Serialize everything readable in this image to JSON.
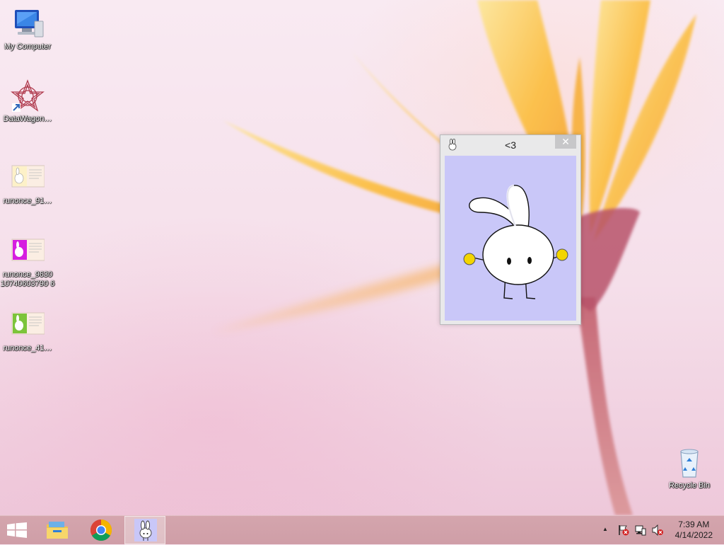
{
  "desktop": {
    "icons": [
      {
        "label": "My Computer",
        "icon": "computer-icon"
      },
      {
        "label": "DataWagon…",
        "icon": "datawagon-icon"
      },
      {
        "label": "runonce_91…",
        "icon": "image-file-icon"
      },
      {
        "label": "runonce_9630 10740603790 6",
        "icon": "image-file-icon"
      },
      {
        "label": "runonce_41…",
        "icon": "image-file-icon"
      },
      {
        "label": "Recycle Bin",
        "icon": "recycle-bin-icon"
      }
    ]
  },
  "window": {
    "title": "<3",
    "close_label": "✕",
    "icon": "bunny-icon",
    "colors": {
      "content_bg": "#c9c7f8",
      "hand": "#f3d500"
    }
  },
  "taskbar": {
    "start": "start-icon",
    "pinned": [
      "file-explorer-icon",
      "chrome-icon",
      "bunny-app-icon"
    ],
    "tray": [
      "show-hidden-icons-icon",
      "action-center-flag-icon",
      "network-icon",
      "volume-muted-icon"
    ],
    "tray_caret": "▲",
    "time": "7:39 AM",
    "date": "4/14/2022"
  }
}
